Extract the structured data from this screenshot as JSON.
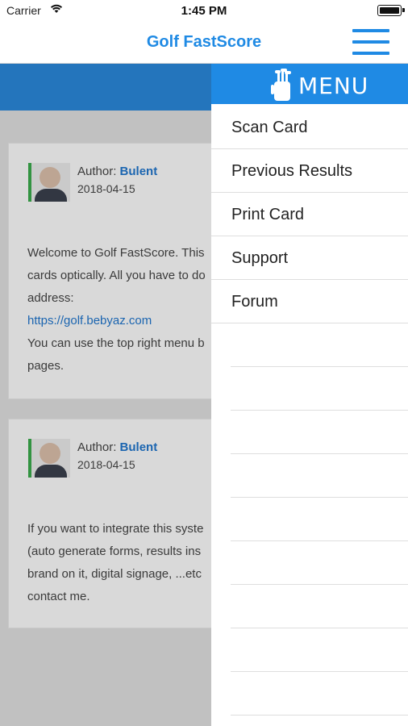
{
  "status": {
    "carrier": "Carrier",
    "time": "1:45 PM"
  },
  "app": {
    "title": "Golf FastScore"
  },
  "posts": [
    {
      "author_prefix": "Author:",
      "author_name": "Bulent",
      "date": "2018-04-15",
      "lines": [
        "Welcome to Golf FastScore. This",
        "cards optically. All you have to do",
        "address:",
        "https://golf.bebyaz.com",
        "You can use the top right menu b",
        "pages."
      ]
    },
    {
      "author_prefix": "Author:",
      "author_name": "Bulent",
      "date": "2018-04-15",
      "lines": [
        "If you want to integrate this syste",
        "(auto generate forms, results ins",
        "brand on it, digital signage, ...etc",
        "contact me."
      ]
    }
  ],
  "menu": {
    "header": "MENU",
    "items": [
      "Scan Card",
      "Previous Results",
      "Print Card",
      "Support",
      "Forum"
    ]
  },
  "icons": {
    "wifi": "wifi-icon",
    "battery": "battery-icon",
    "hamburger": "hamburger-menu-icon",
    "golf_bag": "golf-bag-icon"
  },
  "colors": {
    "accent": "#1f8ae4",
    "link": "#1f73c9",
    "avatar_border": "#39a84a"
  }
}
